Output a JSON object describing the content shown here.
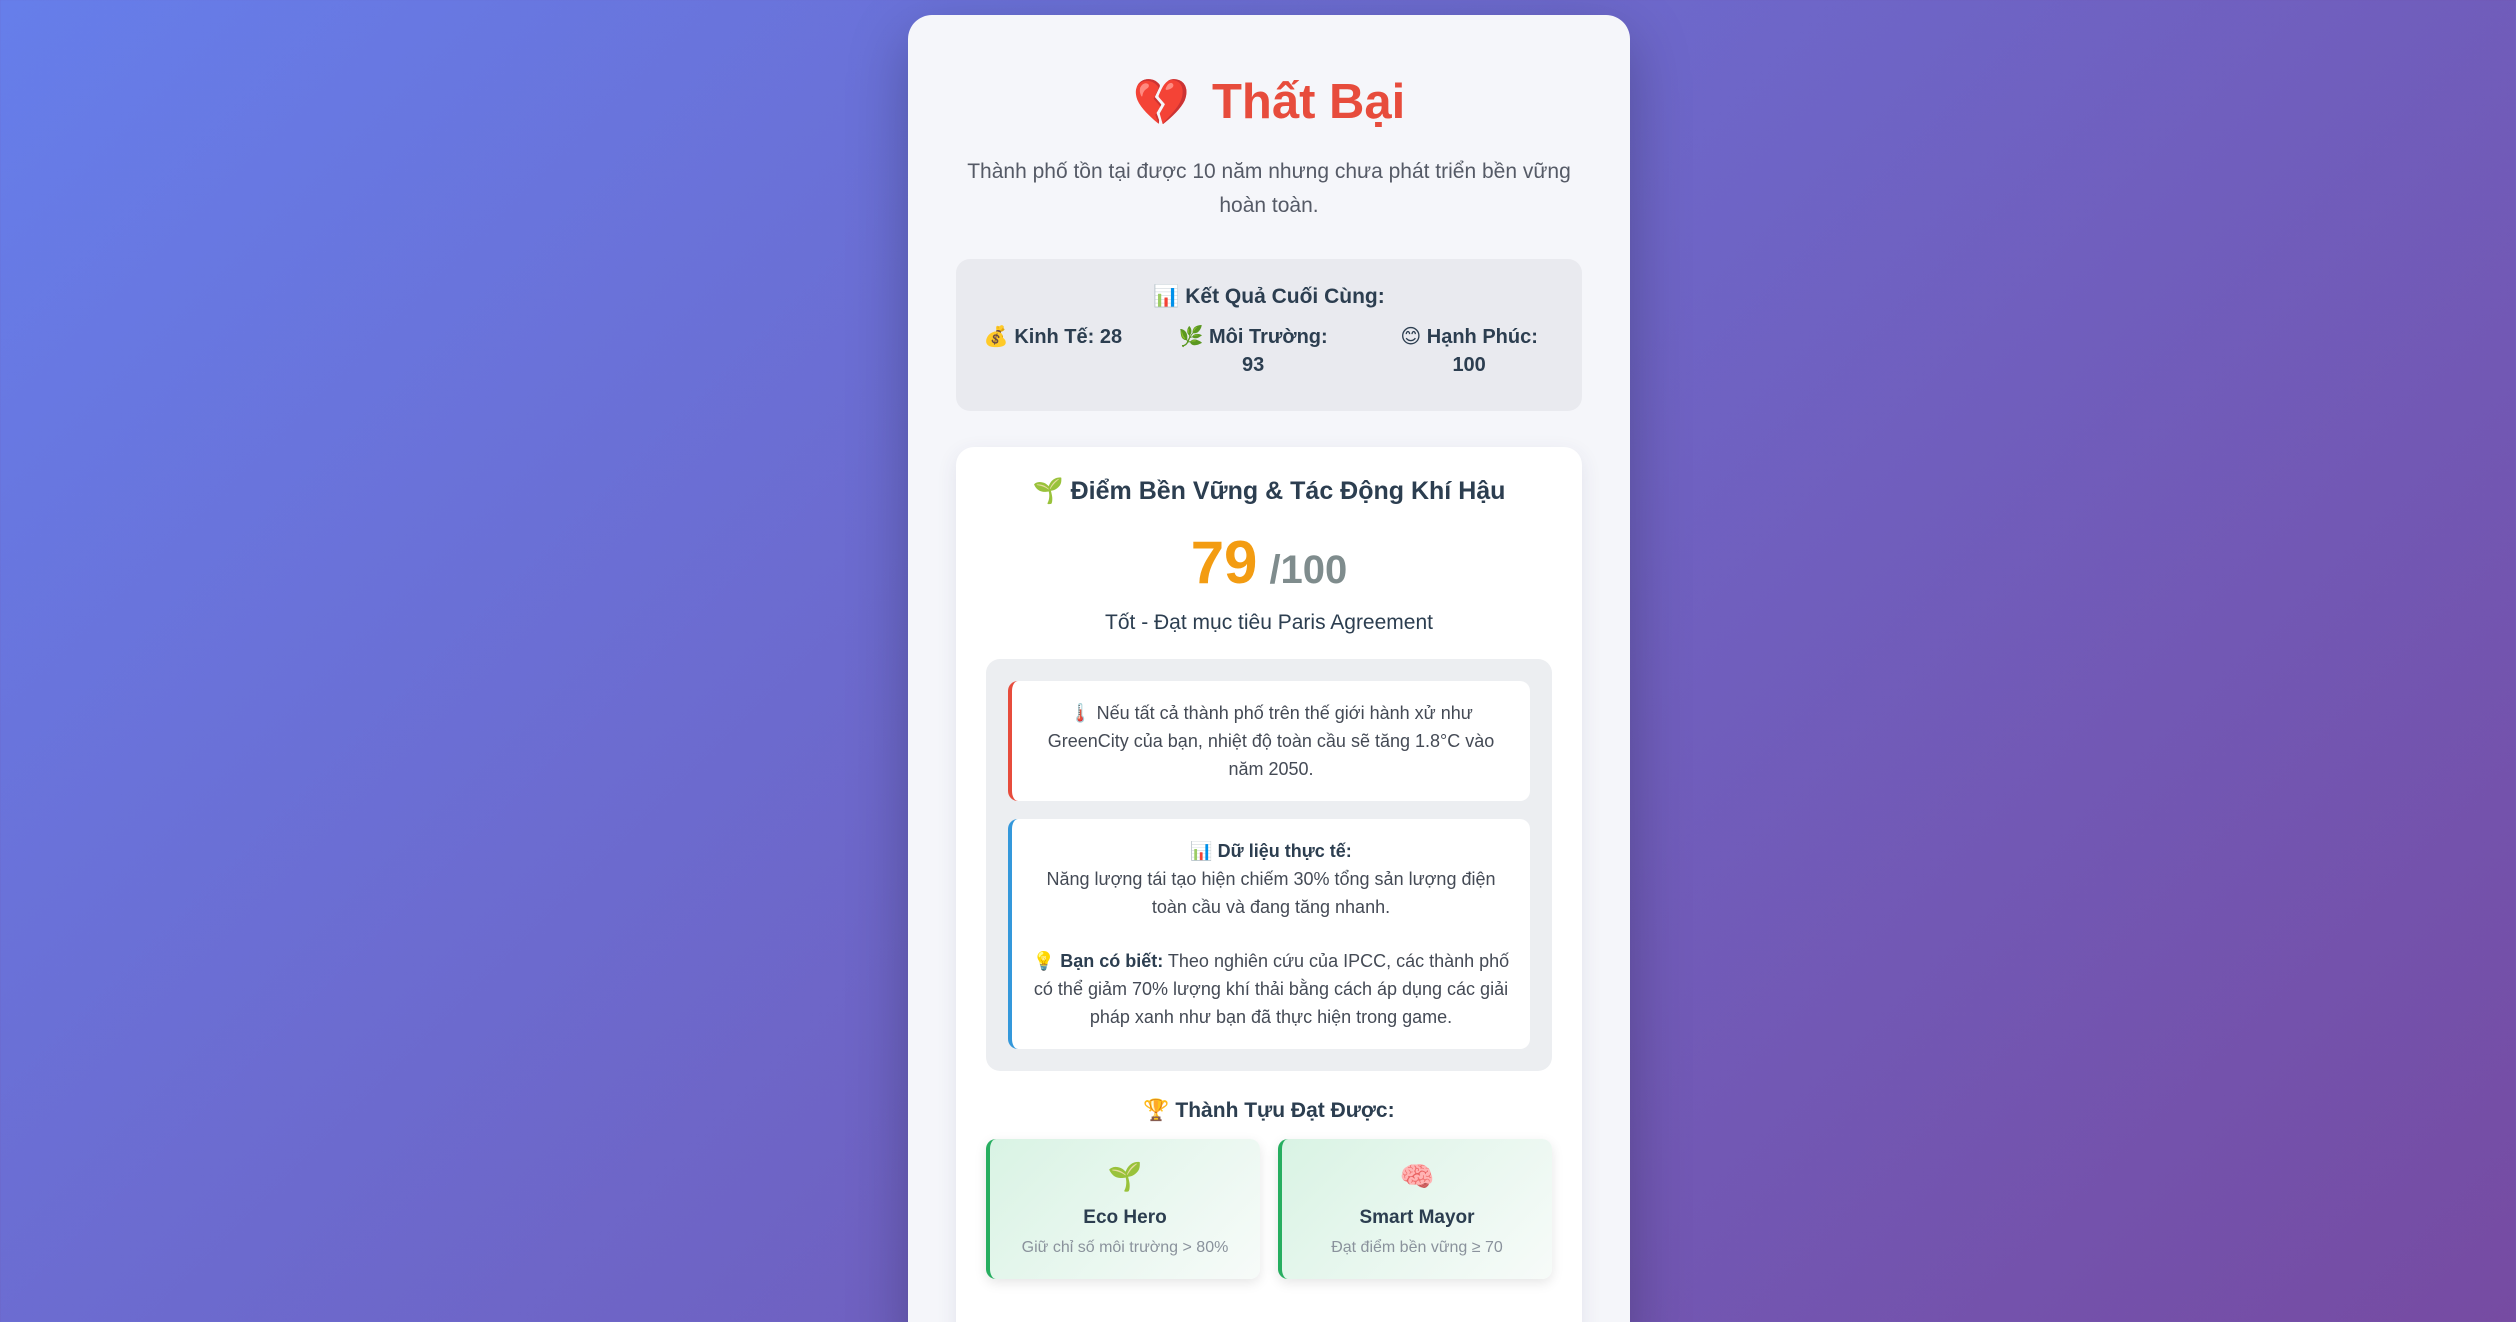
{
  "header": {
    "icon": "broken-heart-icon",
    "title": "Thất Bại",
    "subtitle": "Thành phố tồn tại được 10 năm nhưng chưa phát triển bền vững hoàn toàn."
  },
  "results": {
    "heading": "📊 Kết Quả Cuối Cùng:",
    "stats": [
      {
        "icon": "money-bag-icon",
        "text": "💰 Kinh Tế: 28"
      },
      {
        "icon": "herb-icon",
        "text": "🌿 Môi Trường: 93"
      },
      {
        "icon": "smile-icon",
        "text": "😊 Hạnh Phúc: 100"
      }
    ]
  },
  "sustainability": {
    "heading": "🌱 Điểm Bền Vững & Tác Động Khí Hậu",
    "score": "79",
    "score_max": "/100",
    "rating": "Tốt - Đạt mục tiêu Paris Agreement",
    "climate_note": "🌡️ Nếu tất cả thành phố trên thế giới hành xử như GreenCity của bạn, nhiệt độ toàn cầu sẽ tăng 1.8°C vào năm 2050.",
    "data_label": "📊 Dữ liệu thực tế:",
    "data_text": "Năng lượng tái tạo hiện chiếm 30% tổng sản lượng điện toàn cầu và đang tăng nhanh.",
    "tip_label": "💡 Bạn có biết:",
    "tip_text": " Theo nghiên cứu của IPCC, các thành phố có thể giảm 70% lượng khí thải bằng cách áp dụng các giải pháp xanh như bạn đã thực hiện trong game."
  },
  "achievements": {
    "heading": "🏆 Thành Tựu Đạt Được:",
    "items": [
      {
        "icon": "🌱",
        "icon_name": "seedling-icon",
        "name": "Eco Hero",
        "desc": "Giữ chỉ số môi trường > 80%"
      },
      {
        "icon": "🧠",
        "icon_name": "brain-icon",
        "name": "Smart Mayor",
        "desc": "Đạt điểm bền vững ≥ 70"
      }
    ]
  },
  "colors": {
    "title_red": "#e74c3c",
    "score_orange": "#f39c12",
    "achievement_green": "#27ae60",
    "fact_blue": "#3498db"
  }
}
